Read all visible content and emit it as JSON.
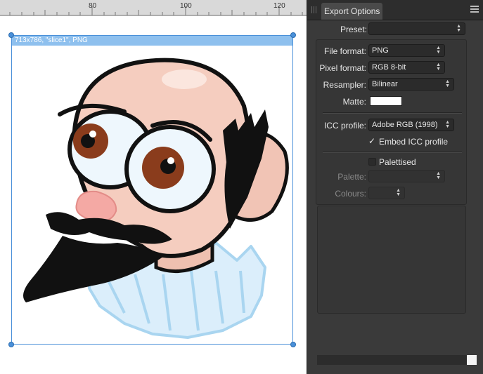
{
  "ruler": {
    "labels": [
      "80",
      "100",
      "120"
    ]
  },
  "slice": {
    "label": "713x786, \"slice1\", PNG"
  },
  "panel": {
    "tab_title": "Export Options",
    "preset": {
      "label": "Preset:",
      "value": ""
    },
    "file_format": {
      "label": "File format:",
      "value": "PNG"
    },
    "pixel_format": {
      "label": "Pixel format:",
      "value": "RGB 8-bit"
    },
    "resampler": {
      "label": "Resampler:",
      "value": "Bilinear"
    },
    "matte": {
      "label": "Matte:",
      "color": "#ffffff"
    },
    "icc_profile": {
      "label": "ICC profile:",
      "value": "Adobe RGB (1998)"
    },
    "embed_icc": {
      "label": "Embed ICC profile",
      "checked": true,
      "check_glyph": "✓"
    },
    "palettised": {
      "label": "Palettised",
      "checked": false
    },
    "palette": {
      "label": "Palette:",
      "value": ""
    },
    "colours": {
      "label": "Colours:",
      "value": ""
    }
  },
  "colors": {
    "panel_bg": "#3a3a3a",
    "selection": "#4a90d9"
  },
  "icons": [
    "panel-grip-icon",
    "panel-menu-icon",
    "dropdown-arrow-icon",
    "checkmark-icon"
  ]
}
